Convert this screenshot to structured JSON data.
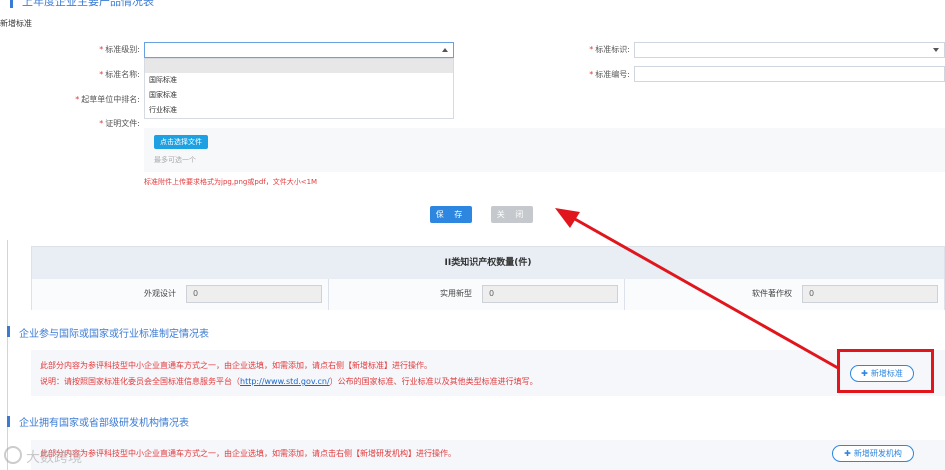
{
  "background_section_title": "上年度企业主要产品情况表",
  "dialog": {
    "title": "新增标准",
    "fields": {
      "level_label": "标准级别:",
      "mark_label": "标准标识:",
      "name_label": "标准名称:",
      "number_label": "标准编号:",
      "rank_label": "起草单位中排名:",
      "file_label": "证明文件:"
    },
    "dropdown_options": [
      "",
      "国际标准",
      "国家标准",
      "行业标准"
    ],
    "choose_file_button": "点击选择文件",
    "max_files_hint": "最多可选一个",
    "upload_hint": "标准附件上传要求格式为jpg,png或pdf，文件大小<1M",
    "save_button": "保 存",
    "close_button": "关 闭"
  },
  "ip_table": {
    "heading": "II类知识产权数量(件)",
    "cells": [
      {
        "label": "外观设计",
        "value": "0"
      },
      {
        "label": "实用新型",
        "value": "0"
      },
      {
        "label": "软件著作权",
        "value": "0"
      }
    ]
  },
  "standards_section": {
    "title": "企业参与国际或国家或行业标准制定情况表",
    "note_line1": "此部分内容为参评科技型中小企业直通车方式之一，由企业选填，如需添加，请点右侧【新增标准】进行操作。",
    "note_line2_prefix": "说明：请按照国家标准化委员会全国标准信息服务平台（",
    "note_link": "http://www.std.gov.cn/",
    "note_line2_suffix": "）公布的国家标准、行业标准以及其他类型标准进行填写。",
    "add_button": "新增标准"
  },
  "rd_section": {
    "title": "企业拥有国家或省部级研发机构情况表",
    "note_line1": "此部分内容为参评科技型中小企业直通车方式之一，由企业选填，如需添加，请点击右侧【新增研发机构】进行操作。",
    "add_button": "新增研发机构"
  },
  "watermark": "大数跨境",
  "colors": {
    "accent": "#2d86e0",
    "title_blue": "#3b7bd4",
    "required_red": "#e4393c",
    "annotation_red": "#e0161c"
  }
}
